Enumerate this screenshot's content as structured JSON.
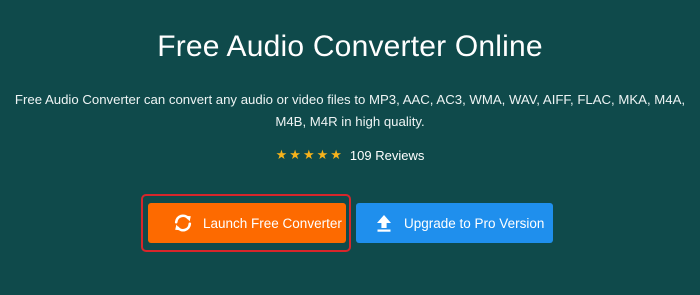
{
  "hero": {
    "title": "Free Audio Converter Online",
    "description": "Free Audio Converter can convert any audio or video files to MP3, AAC, AC3, WMA, WAV, AIFF, FLAC, MKA, M4A, M4B, M4R in high quality.",
    "rating": {
      "stars": 5,
      "max_stars": 5,
      "reviews_label": "109 Reviews",
      "star_color": "#f6b31b"
    }
  },
  "buttons": {
    "launch": {
      "label": "Launch Free Converter",
      "icon": "refresh-convert-icon",
      "color": "#fd6a00",
      "highlighted": true,
      "highlight_color": "#d7262b"
    },
    "upgrade": {
      "label": "Upgrade to Pro Version",
      "icon": "upload-arrow-icon",
      "color": "#1f8fed"
    }
  },
  "colors": {
    "background": "#0f4a4b",
    "text": "#ffffff"
  }
}
